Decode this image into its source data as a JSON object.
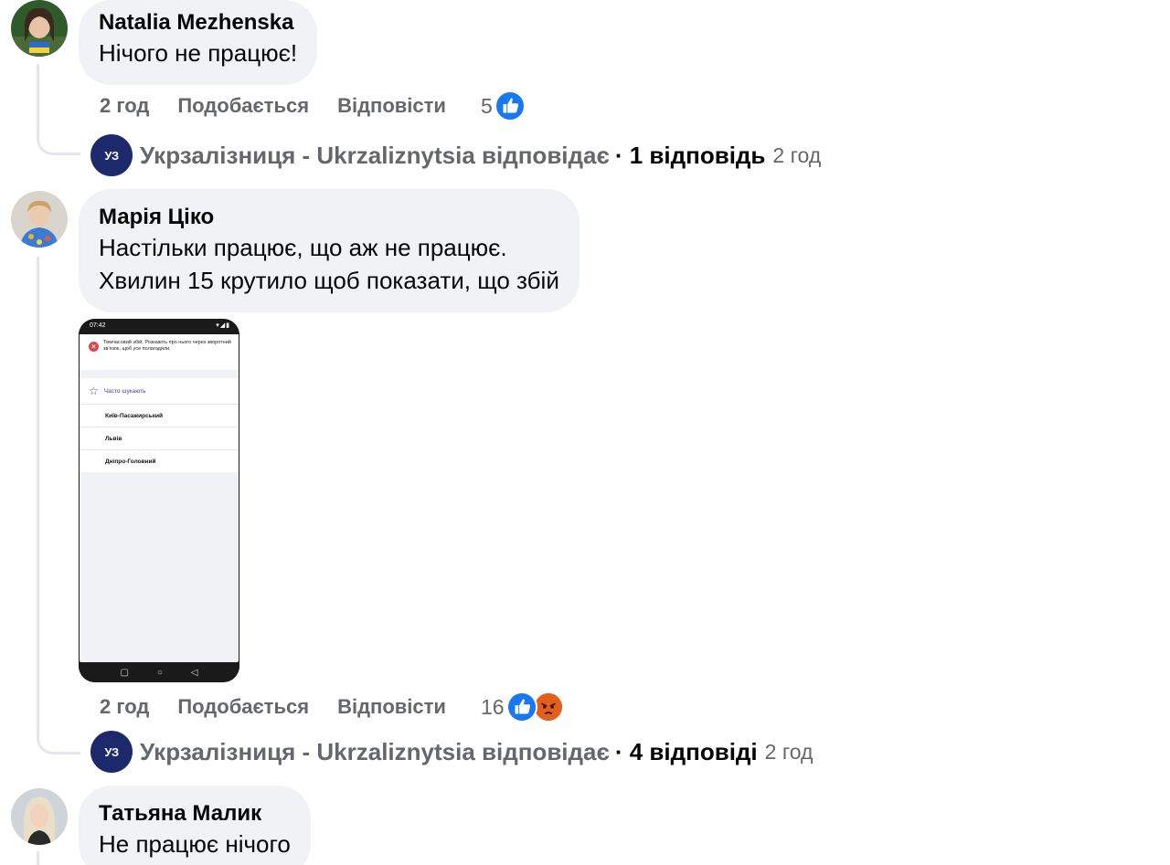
{
  "comments": [
    {
      "author": "Natalia Mezhenska",
      "lines": [
        "Нічого не працює!"
      ],
      "time": "2 год",
      "like_label": "Подобається",
      "reply_label": "Відповісти",
      "reaction_count": "5",
      "reactions": [
        "like"
      ],
      "reply_summary": {
        "page_text": "Укрзалізниця - Ukrzaliznytsia відповідає",
        "count_text": "· 1 відповідь",
        "time": "2 год",
        "logo_text": "УЗ"
      }
    },
    {
      "author": "Марія Ціко",
      "lines": [
        "Настільки працює, що аж не працює.",
        "Хвилин 15 крутило щоб показати, що збій"
      ],
      "attachment": {
        "status_time": "07:42",
        "error_text": "Тимчасовий збій. Розкажіть про нього через зворотний зв'язок, щоб усе полагодили.",
        "section_title": "Часто шукають",
        "stations": [
          "Київ-Пасажирський",
          "Львів",
          "Дніпро-Головний"
        ],
        "nav_icons": [
          "square",
          "circle",
          "triangle"
        ]
      },
      "time": "2 год",
      "like_label": "Подобається",
      "reply_label": "Відповісти",
      "reaction_count": "16",
      "reactions": [
        "like",
        "angry"
      ],
      "reply_summary": {
        "page_text": "Укрзалізниця - Ukrzaliznytsia відповідає",
        "count_text": "· 4 відповіді",
        "time": "2 год",
        "logo_text": "УЗ"
      }
    },
    {
      "author": "Татьяна Малик",
      "lines": [
        "Не працює нічого"
      ]
    }
  ],
  "colors": {
    "bubble": "#f0f2f5",
    "secondary_text": "#65676b",
    "like_blue": "#1877f2",
    "angry_orange": "#e9710f",
    "uz_navy": "#1c2a6b"
  }
}
